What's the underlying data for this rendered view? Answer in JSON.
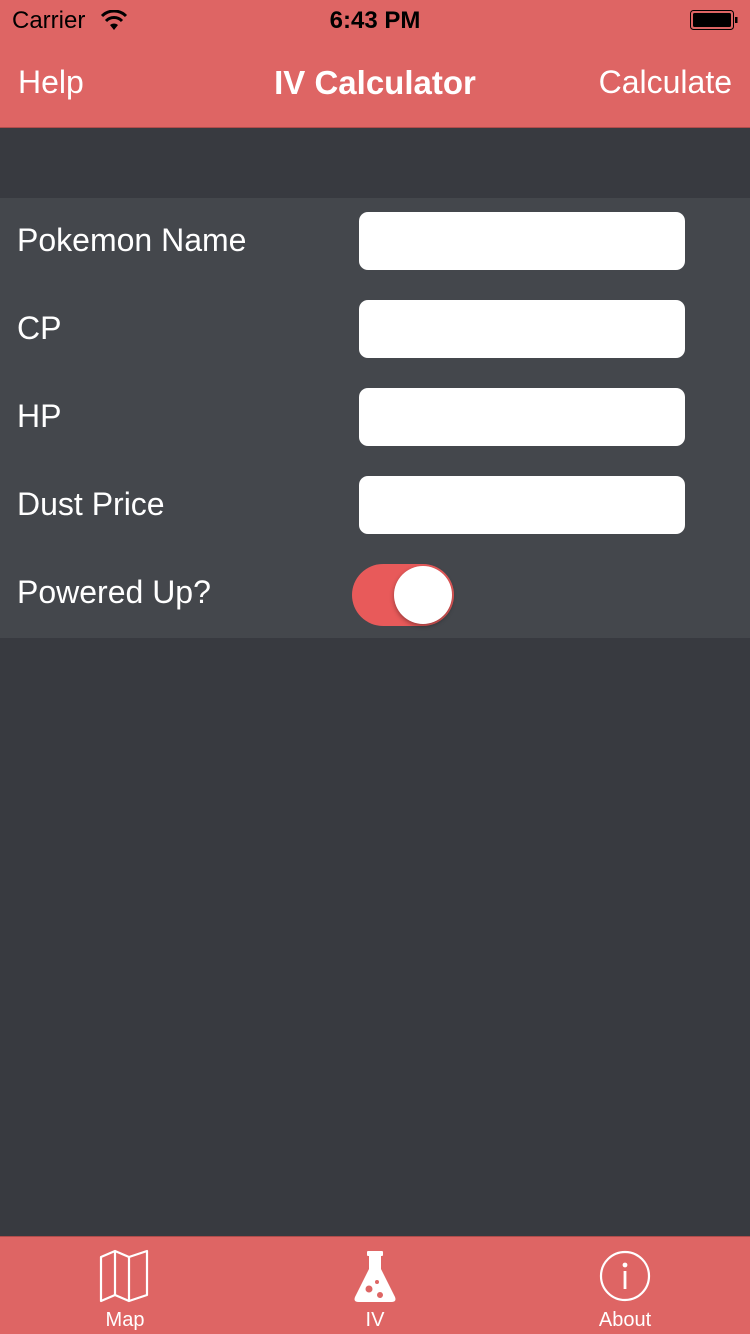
{
  "status_bar": {
    "carrier": "Carrier",
    "time": "6:43 PM"
  },
  "nav": {
    "left": "Help",
    "title": "IV Calculator",
    "right": "Calculate"
  },
  "form": {
    "rows": [
      {
        "label": "Pokemon Name",
        "value": "",
        "placeholder": ""
      },
      {
        "label": "CP",
        "value": "",
        "placeholder": ""
      },
      {
        "label": "HP",
        "value": "",
        "placeholder": ""
      },
      {
        "label": "Dust Price",
        "value": "",
        "placeholder": ""
      }
    ],
    "toggle": {
      "label": "Powered Up?",
      "on": true
    }
  },
  "tabs": [
    {
      "label": "Map",
      "icon": "map-icon"
    },
    {
      "label": "IV",
      "icon": "flask-icon"
    },
    {
      "label": "About",
      "icon": "info-icon"
    }
  ],
  "colors": {
    "accent": "#de6564",
    "background": "#383a40",
    "form_bg": "#44474c",
    "toggle_on": "#e85a5a"
  }
}
